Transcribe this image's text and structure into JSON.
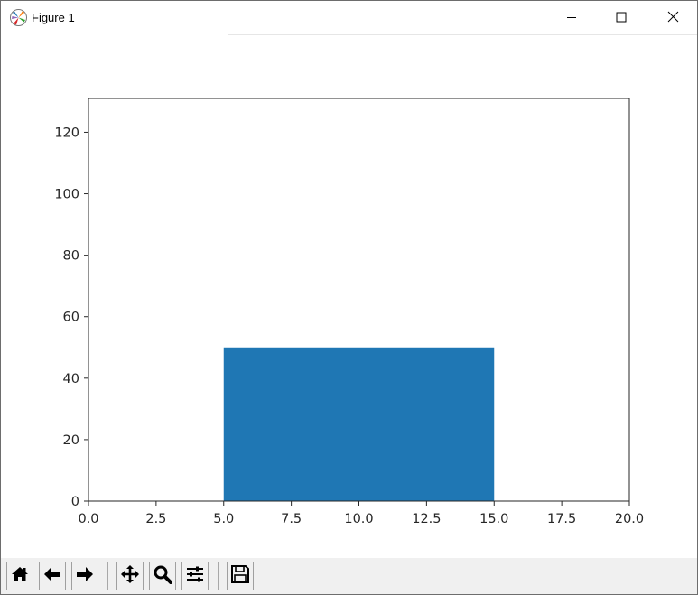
{
  "window": {
    "title": "Figure 1",
    "icon": "matplotlib-logo-icon",
    "controls": [
      "minimize-icon",
      "maximize-icon",
      "close-icon"
    ]
  },
  "colors": {
    "bar": "#1f77b4",
    "axes": "#262626",
    "toolbar_bg": "#f0f0f0"
  },
  "toolbar": {
    "buttons": [
      "home-icon",
      "back-arrow-icon",
      "forward-arrow-icon",
      "pan-icon",
      "zoom-icon",
      "configure-subplots-icon",
      "save-icon"
    ]
  },
  "chart_data": {
    "type": "bar",
    "title": "",
    "xlabel": "",
    "ylabel": "",
    "bars": [
      {
        "x_left": 5.0,
        "x_right": 15.0,
        "height": 50
      }
    ],
    "xlim": [
      0,
      20
    ],
    "ylim": [
      0,
      131
    ],
    "x_ticks": [
      "0.0",
      "2.5",
      "5.0",
      "7.5",
      "10.0",
      "12.5",
      "15.0",
      "17.5",
      "20.0"
    ],
    "y_ticks": [
      "0",
      "20",
      "40",
      "60",
      "80",
      "100",
      "120"
    ],
    "grid": false,
    "legend": "none"
  }
}
